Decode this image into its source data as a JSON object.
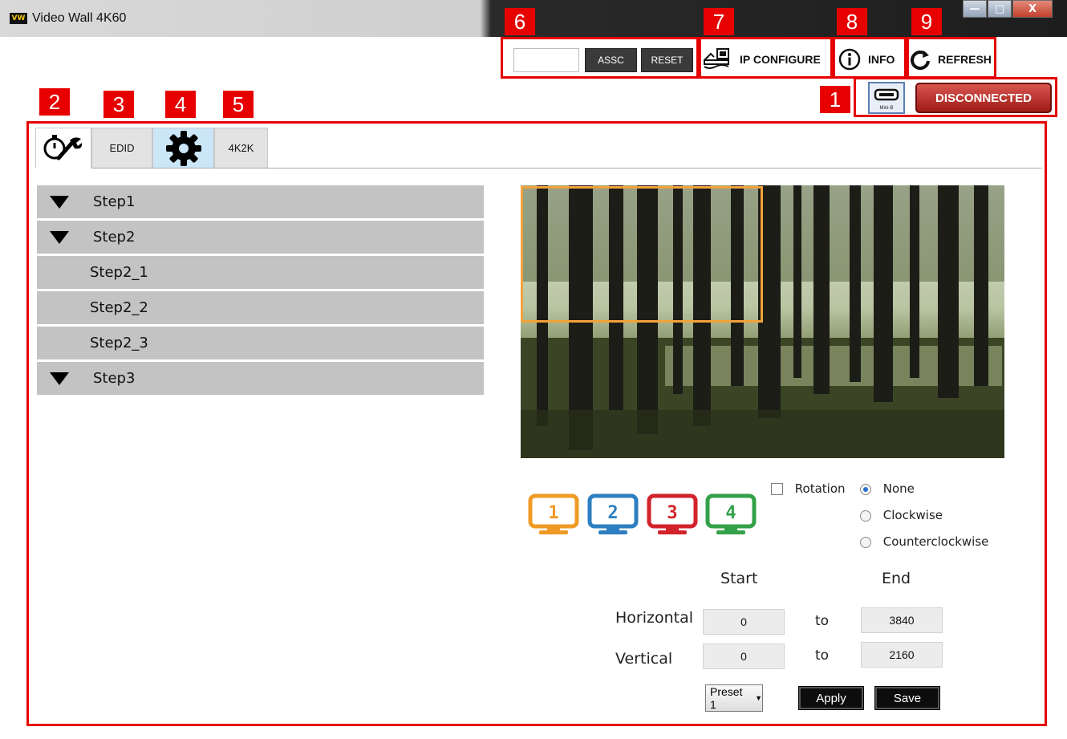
{
  "window": {
    "logo_text": "VW",
    "title": "Video Wall 4K60",
    "minimize": "—",
    "maximize": "□",
    "close": "X"
  },
  "toolbar": {
    "assc_input_value": "",
    "assc_label": "ASSC",
    "reset_label": "RESET",
    "ip_configure_label": "IP CONFIGURE",
    "info_label": "INFO",
    "refresh_label": "REFRESH"
  },
  "connection": {
    "port_label": "Mini-B",
    "status": "DISCONNECTED",
    "status_color": "#b4231c"
  },
  "callouts": [
    "1",
    "2",
    "3",
    "4",
    "5",
    "6",
    "7",
    "8",
    "9"
  ],
  "tabs": [
    {
      "label": "",
      "icon": "wrench-clock-icon"
    },
    {
      "label": "EDID"
    },
    {
      "label": "",
      "icon": "gear-icon"
    },
    {
      "label": "4K2K"
    }
  ],
  "steps": [
    {
      "label": "Step1",
      "expandable": true
    },
    {
      "label": "Step2",
      "expandable": true
    },
    {
      "label": "Step2_1",
      "expandable": false
    },
    {
      "label": "Step2_2",
      "expandable": false
    },
    {
      "label": "Step2_3",
      "expandable": false
    },
    {
      "label": "Step3",
      "expandable": true
    }
  ],
  "monitors": [
    {
      "number": "1",
      "color": "#f09a26"
    },
    {
      "number": "2",
      "color": "#2d7fc1"
    },
    {
      "number": "3",
      "color": "#d2232a"
    },
    {
      "number": "4",
      "color": "#33a14a"
    }
  ],
  "rotation": {
    "checkbox_label": "Rotation",
    "checked": false,
    "options": [
      "None",
      "Clockwise",
      "Counterclockwise"
    ],
    "selected": "None"
  },
  "range": {
    "start_header": "Start",
    "end_header": "End",
    "to_label": "to",
    "horizontal_label": "Horizontal",
    "horizontal_start": "0",
    "horizontal_end": "3840",
    "vertical_label": "Vertical",
    "vertical_start": "0",
    "vertical_end": "2160"
  },
  "actions": {
    "preset_value": "Preset 1",
    "apply_label": "Apply",
    "save_label": "Save"
  }
}
